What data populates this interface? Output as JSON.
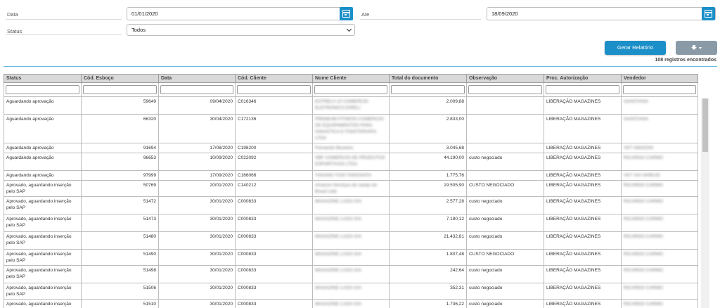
{
  "filters": {
    "date_label": "Data",
    "date_value": "01/01/2020",
    "until_label": "Ate",
    "until_value": "18/09/2020",
    "status_label": "Status",
    "status_value": "Todos"
  },
  "toolbar": {
    "report_label": "Gerar Relatório",
    "export_icon": "download-icon",
    "records_text": "108 registros encontrados"
  },
  "table": {
    "columns": [
      "Status",
      "Cód. Esboço",
      "Data",
      "Cód. Cliente",
      "Nome Cliente",
      "Total do documento",
      "Observação",
      "Proc. Autorização",
      "Vendedor"
    ],
    "rows": [
      [
        "Aguardando aprovação",
        "59649",
        "09/04/2020",
        "C016346",
        "ESTRELA 10 COMERCIO ELETRONICO EIRELI",
        "2.009,88",
        "",
        "LIBERAÇÃO MAGAZINES",
        "GIANTIANA"
      ],
      [
        "Aguardando aprovação",
        "66320",
        "30/04/2020",
        "C172136",
        "PREMIUM FITNESS COMERCIO DE EQUIPAMENTOS PARA GINASTICA E FISIOTERAPIA LTDA",
        "2.833,00",
        "",
        "LIBERAÇÃO MAGAZINES",
        "GIANTIANA"
      ],
      [
        "Aguardando aprovação",
        "91694",
        "17/08/2020",
        "C198200",
        "Fernando Mucelon",
        "3.045,68",
        "",
        "LIBERAÇÃO MAGAZINES",
        "VKT AMAZON"
      ],
      [
        "Aguardando aprovação",
        "96653",
        "10/09/2020",
        "C022092",
        "SBF COMERCIO DE PRODUTOS ESPORTIVOS LTDA",
        "44.190,00",
        "custo negociado",
        "LIBERAÇÃO MAGAZINES",
        "RICARDO CARMO"
      ],
      [
        "Aguardando aprovação",
        "97999",
        "17/09/2020",
        "C166066",
        "TAKANO YOSI TAKESHITA",
        "1.775,76",
        "",
        "LIBERAÇÃO MAGAZINES",
        "VKT VIA VAREJO"
      ],
      [
        "Aprovado, aguardando inserção pelo SAP",
        "50769",
        "20/01/2020",
        "C140212",
        "Amazon Serviços de varejo do Brasil Ltda",
        "19.505,90",
        "CUSTO NEGOCIADO",
        "LIBERAÇÃO MAGAZINES",
        "RICARDO CARMO"
      ],
      [
        "Aprovado, aguardando inserção pelo SAP",
        "51472",
        "30/01/2020",
        "C000833",
        "MAGAZINE LUIZA S/A",
        "2.577,28",
        "custo negociado",
        "LIBERAÇÃO MAGAZINES",
        "RICARDO CARMO"
      ],
      [
        "Aprovado, aguardando inserção pelo SAP",
        "51473",
        "30/01/2020",
        "C000833",
        "MAGAZINE LUIZA S/A",
        "7.180,12",
        "custo negociado",
        "LIBERAÇÃO MAGAZINES",
        "RICARDO CARMO"
      ],
      [
        "Aprovado, aguardando inserção pelo SAP",
        "51480",
        "30/01/2020",
        "C000833",
        "MAGAZINE LUIZA S/A",
        "21.432,81",
        "custo negociado",
        "LIBERAÇÃO MAGAZINES",
        "RICARDO CARMO"
      ],
      [
        "Aprovado, aguardando inserção pelo SAP",
        "51490",
        "30/01/2020",
        "C000833",
        "MAGAZINE LUIZA S/A",
        "1.807,48",
        "CUSTO NEGOCIADO",
        "LIBERAÇÃO MAGAZINES",
        "RICARDO CARMO"
      ],
      [
        "Aprovado, aguardando inserção pelo SAP",
        "51498",
        "30/01/2020",
        "C000833",
        "MAGAZINE LUIZA S/A",
        "242,64",
        "custo negociado",
        "LIBERAÇÃO MAGAZINES",
        "RICARDO CARMO"
      ],
      [
        "Aprovado, aguardando inserção pelo SAP",
        "51506",
        "30/01/2020",
        "C000833",
        "MAGAZINE LUIZA S/A",
        "352,31",
        "custo negociado",
        "LIBERAÇÃO MAGAZINES",
        "RICARDO CARMO"
      ],
      [
        "Aprovado, aguardando inserção pelo SAP",
        "51510",
        "30/01/2020",
        "C000833",
        "MAGAZINE LUIZA S/A",
        "1.736,22",
        "custo negociado",
        "LIBERAÇÃO MAGAZINES",
        "RICARDO CARMO"
      ]
    ]
  }
}
